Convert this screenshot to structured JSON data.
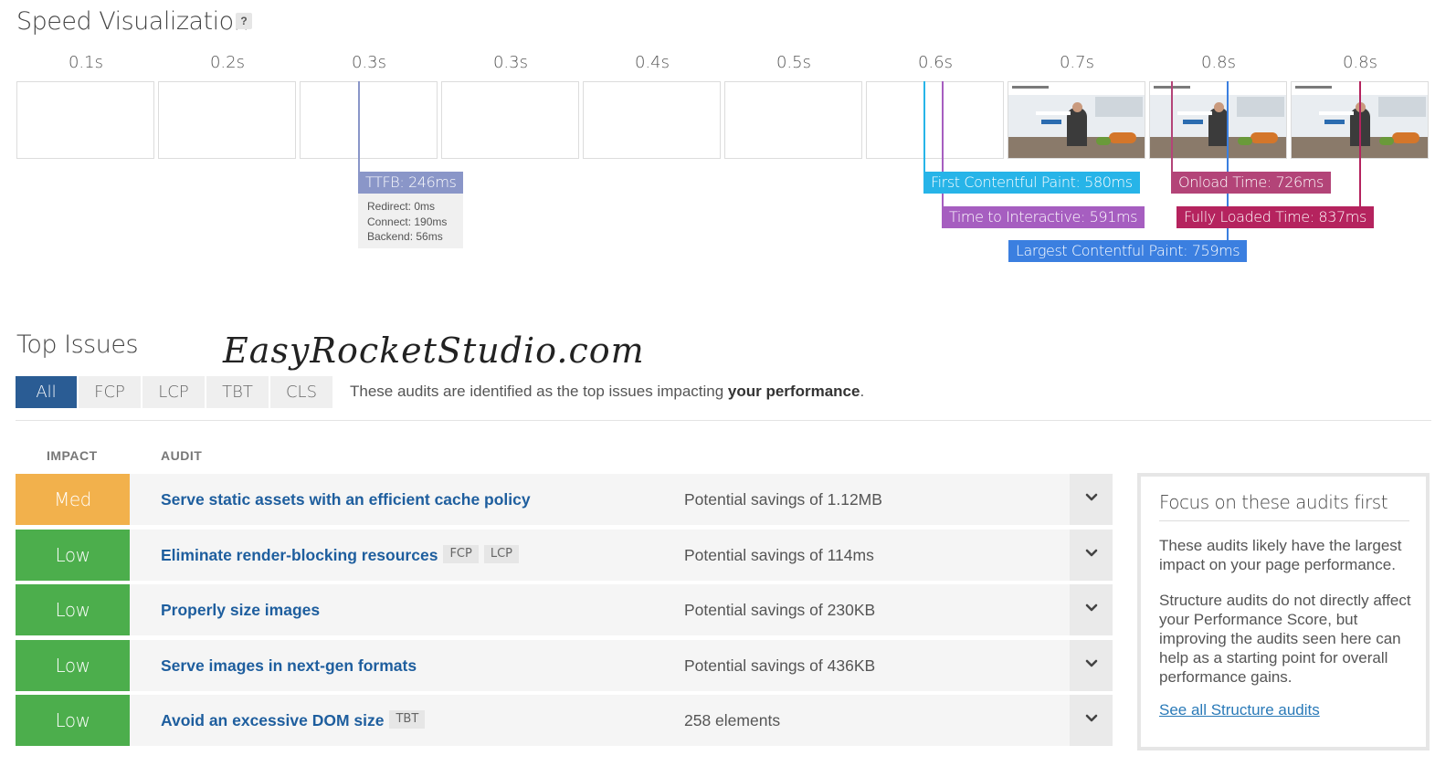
{
  "speed_visualization": {
    "title": "Speed Visualization",
    "help": "?",
    "ticks": [
      "0.1s",
      "0.2s",
      "0.3s",
      "0.3s",
      "0.4s",
      "0.5s",
      "0.6s",
      "0.7s",
      "0.8s",
      "0.8s"
    ],
    "frames": [
      "blank",
      "blank",
      "blank",
      "blank",
      "blank",
      "blank",
      "blank",
      "screenshot",
      "screenshot",
      "screenshot"
    ],
    "markers": {
      "ttfb": {
        "label": "TTFB: 246ms",
        "color": "#8a96c8",
        "details": [
          "Redirect: 0ms",
          "Connect: 190ms",
          "Backend: 56ms"
        ]
      },
      "fcp": {
        "label": "First Contentful Paint: 580ms",
        "color": "#27b4e8"
      },
      "tti": {
        "label": "Time to Interactive: 591ms",
        "color": "#a65ec0"
      },
      "lcp": {
        "label": "Largest Contentful Paint: 759ms",
        "color": "#3b7fe0"
      },
      "onload": {
        "label": "Onload Time: 726ms",
        "color": "#b34478"
      },
      "fully_loaded": {
        "label": "Fully Loaded Time: 837ms",
        "color": "#b5235e"
      }
    }
  },
  "top_issues": {
    "title": "Top Issues",
    "watermark": "EasyRocketStudio.com",
    "tabs": [
      "All",
      "FCP",
      "LCP",
      "TBT",
      "CLS"
    ],
    "active_tab": "All",
    "description_prefix": "These audits are identified as the top issues impacting ",
    "description_bold": "your performance",
    "description_suffix": ".",
    "columns": {
      "impact": "IMPACT",
      "audit": "AUDIT"
    },
    "impact_colors": {
      "Med": "#f2b14c",
      "Low": "#4cae4c"
    },
    "rows": [
      {
        "impact": "Med",
        "audit": "Serve static assets with an efficient cache policy",
        "tags": [],
        "savings": "Potential savings of 1.12MB"
      },
      {
        "impact": "Low",
        "audit": "Eliminate render-blocking resources",
        "tags": [
          "FCP",
          "LCP"
        ],
        "savings": "Potential savings of 114ms"
      },
      {
        "impact": "Low",
        "audit": "Properly size images",
        "tags": [],
        "savings": "Potential savings of 230KB"
      },
      {
        "impact": "Low",
        "audit": "Serve images in next-gen formats",
        "tags": [],
        "savings": "Potential savings of 436KB"
      },
      {
        "impact": "Low",
        "audit": "Avoid an excessive DOM size",
        "tags": [
          "TBT"
        ],
        "savings": "258 elements"
      }
    ]
  },
  "focus_box": {
    "title": "Focus on these audits first",
    "paragraph1": "These audits likely have the largest impact on your page performance.",
    "paragraph2": "Structure audits do not directly affect your Performance Score, but improving the audits seen here can help as a starting point for overall performance gains.",
    "link": "See all Structure audits"
  }
}
